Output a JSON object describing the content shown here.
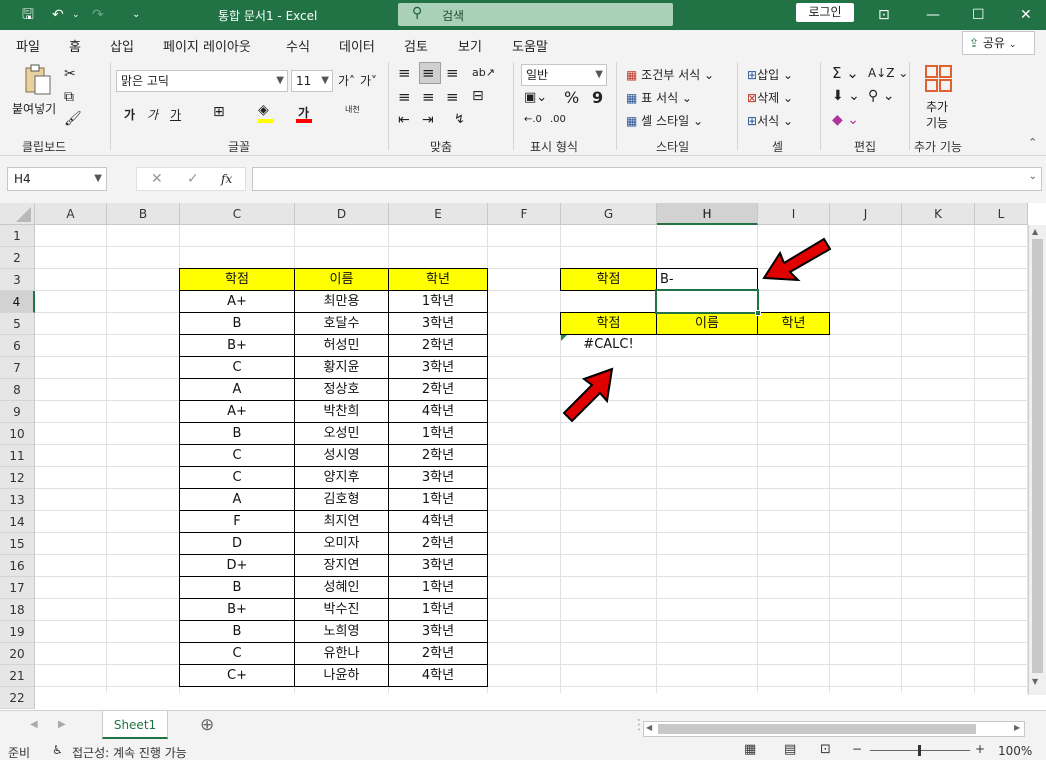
{
  "titlebar": {
    "title": "통합 문서1  -  Excel",
    "search_label": "검색",
    "login_label": "로그인"
  },
  "menu": {
    "tabs": [
      "파일",
      "홈",
      "삽입",
      "페이지 레이아웃",
      "수식",
      "데이터",
      "검토",
      "보기",
      "도움말"
    ],
    "active_tab": "홈",
    "share_label": "공유"
  },
  "ribbon": {
    "clipboard": {
      "paste": "붙여넣기",
      "label": "클립보드"
    },
    "font": {
      "font_name": "맑은 고딕",
      "font_size": "11",
      "bold": "가",
      "italic": "가",
      "underline": "가",
      "font_color": "가",
      "phonetic": "내천",
      "label": "글꼴"
    },
    "align": {
      "label": "맞춤"
    },
    "number": {
      "format": "일반",
      "percent": "%",
      "comma": "9",
      "label": "표시 형식"
    },
    "styles": {
      "conditional": "조건부 서식",
      "table": "표 서식",
      "cell": "셀 스타일",
      "label": "스타일"
    },
    "cells": {
      "insert": "삽입",
      "delete": "삭제",
      "format": "서식",
      "label": "셀"
    },
    "editing": {
      "label": "편집"
    },
    "addins": {
      "button": "추가 기능",
      "line1": "추가",
      "line2": "기능",
      "label": "추가 기능"
    }
  },
  "formula_bar": {
    "name_box": "H4",
    "fx": "fx",
    "value": ""
  },
  "columns": [
    "A",
    "B",
    "C",
    "D",
    "E",
    "F",
    "G",
    "H",
    "I",
    "J",
    "K",
    "L"
  ],
  "selected_column": "H",
  "selected_row": 4,
  "rows": [
    "1",
    "2",
    "3",
    "4",
    "5",
    "6",
    "7",
    "8",
    "9",
    "10",
    "11",
    "12",
    "13",
    "14",
    "15",
    "16",
    "17",
    "18",
    "19",
    "20",
    "21",
    "22"
  ],
  "table": {
    "headers": [
      "학점",
      "이름",
      "학년"
    ],
    "records": [
      [
        "A+",
        "최만용",
        "1학년"
      ],
      [
        "B",
        "호달수",
        "3학년"
      ],
      [
        "B+",
        "허성민",
        "2학년"
      ],
      [
        "C",
        "황지윤",
        "3학년"
      ],
      [
        "A",
        "정상호",
        "2학년"
      ],
      [
        "A+",
        "박찬희",
        "4학년"
      ],
      [
        "B",
        "오성민",
        "1학년"
      ],
      [
        "C",
        "성시영",
        "2학년"
      ],
      [
        "C",
        "양지후",
        "3학년"
      ],
      [
        "A",
        "김호형",
        "1학년"
      ],
      [
        "F",
        "최지연",
        "4학년"
      ],
      [
        "D",
        "오미자",
        "2학년"
      ],
      [
        "D+",
        "장지연",
        "3학년"
      ],
      [
        "B",
        "성혜인",
        "1학년"
      ],
      [
        "B+",
        "박수진",
        "1학년"
      ],
      [
        "B",
        "노희영",
        "3학년"
      ],
      [
        "C",
        "유한나",
        "2학년"
      ],
      [
        "C+",
        "나윤하",
        "4학년"
      ]
    ]
  },
  "criteria": {
    "label": "학점",
    "value": "B-"
  },
  "result": {
    "headers": [
      "학점",
      "이름",
      "학년"
    ],
    "error": "#CALC!"
  },
  "sheet_tab": "Sheet1",
  "status": {
    "ready": "준비",
    "accessibility": "접근성: 계속 진행 가능",
    "zoom": "100%"
  },
  "colors": {
    "excel_green": "#217346",
    "header_yellow": "#ffff00",
    "arrow_red": "#e00000"
  }
}
